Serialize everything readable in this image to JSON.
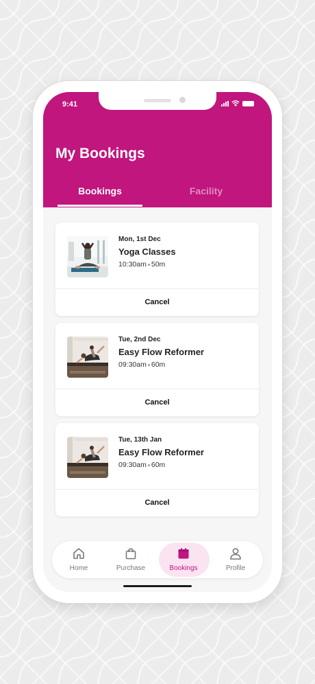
{
  "status_bar": {
    "time": "9:41"
  },
  "header": {
    "title": "My Bookings",
    "tabs": [
      {
        "label": "Bookings",
        "active": true
      },
      {
        "label": "Facility",
        "active": false
      }
    ]
  },
  "bookings": [
    {
      "date": "Mon, 1st Dec",
      "title": "Yoga Classes",
      "time": "10:30am",
      "duration": "50m",
      "cancel_label": "Cancel",
      "image": "yoga-photo"
    },
    {
      "date": "Tue, 2nd Dec",
      "title": "Easy Flow Reformer",
      "time": "09:30am",
      "duration": "60m",
      "cancel_label": "Cancel",
      "image": "reformer-photo"
    },
    {
      "date": "Tue, 13th Jan",
      "title": "Easy Flow Reformer",
      "time": "09:30am",
      "duration": "60m",
      "cancel_label": "Cancel",
      "image": "reformer-photo"
    }
  ],
  "nav": {
    "items": [
      {
        "label": "Home",
        "icon": "home-icon"
      },
      {
        "label": "Purchase",
        "icon": "shopping-bag-icon"
      },
      {
        "label": "Bookings",
        "icon": "calendar-icon",
        "active": true
      },
      {
        "label": "Profile",
        "icon": "person-icon"
      }
    ]
  },
  "colors": {
    "brand": "#c0167e",
    "tab_inactive": "#e28ac0",
    "nav_active_bg": "#fbe4f1",
    "background": "#f6f6f6"
  }
}
